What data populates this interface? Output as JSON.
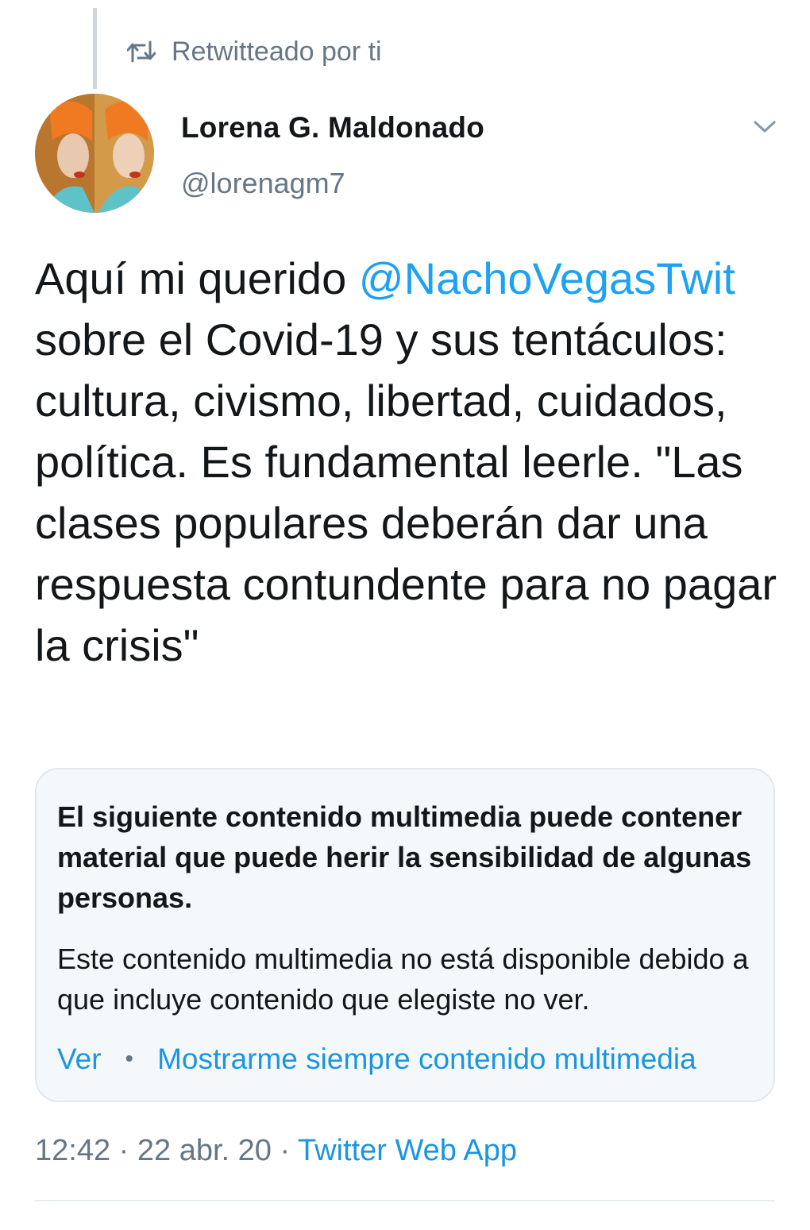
{
  "retweet_banner": {
    "icon": "retweet-icon",
    "text": "Retwitteado por ti"
  },
  "author": {
    "display_name": "Lorena G. Maldonado",
    "handle": "@lorenagm7",
    "avatar_icon": "avatar-photo"
  },
  "tweet": {
    "text_before_mention": "Aquí mi querido ",
    "mention": "@NachoVegasTwit",
    "text_after_mention": " sobre el Covid-19 y sus tentáculos: cultura, civismo, libertad, cuidados, política. Es fundamental leerle. \"Las clases populares deberán dar una respuesta contundente para no pagar la crisis\""
  },
  "media_warning": {
    "title": "El siguiente contenido multimedia puede contener material que puede herir la sensibilidad de algunas personas.",
    "body": "Este contenido multimedia no está disponible debido a que incluye contenido que elegiste no ver.",
    "view_label": "Ver",
    "separator": "•",
    "always_show_label": "Mostrarme siempre contenido multimedia"
  },
  "meta": {
    "time": "12:42",
    "sep1": " · ",
    "date": "22 abr. 20",
    "sep2": " · ",
    "source": "Twitter Web App"
  },
  "colors": {
    "accent": "#1da1f2",
    "link": "#1b95e0",
    "secondary_text": "#657786",
    "card_background": "#f5f8fa",
    "border": "#e1e8ed"
  }
}
